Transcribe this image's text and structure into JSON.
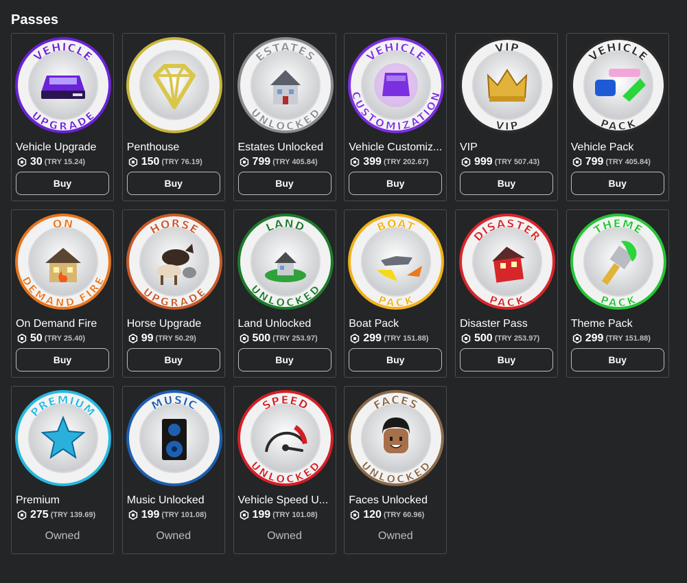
{
  "page": {
    "title": "Passes"
  },
  "passes": [
    {
      "name": "Vehicle Upgrade",
      "price": "30",
      "price_try": "(TRY 15.24)",
      "action": "Buy",
      "owned": false,
      "icon": "vehicle-upgrade-badge-icon",
      "badge_top": "VEHICLE",
      "badge_bottom": "UPGRADE",
      "accent": "#6a23d6"
    },
    {
      "name": "Penthouse",
      "price": "150",
      "price_try": "(TRY 76.19)",
      "action": "Buy",
      "owned": false,
      "icon": "penthouse-diamond-badge-icon",
      "badge_top": "",
      "badge_bottom": "",
      "accent": "#c8b53a"
    },
    {
      "name": "Estates Unlocked",
      "price": "799",
      "price_try": "(TRY 405.84)",
      "action": "Buy",
      "owned": false,
      "icon": "estates-unlocked-badge-icon",
      "badge_top": "ESTATES",
      "badge_bottom": "UNLOCKED",
      "accent": "#8a8c90"
    },
    {
      "name": "Vehicle Customiz...",
      "price": "399",
      "price_try": "(TRY 202.67)",
      "action": "Buy",
      "owned": false,
      "icon": "vehicle-customization-badge-icon",
      "badge_top": "VEHICLE",
      "badge_bottom": "CUSTOMIZATION",
      "accent": "#7b2fe0"
    },
    {
      "name": "VIP",
      "price": "999",
      "price_try": "(TRY 507.43)",
      "action": "Buy",
      "owned": false,
      "icon": "vip-crown-badge-icon",
      "badge_top": "VIP",
      "badge_bottom": "VIP",
      "accent": "#2b2b2b"
    },
    {
      "name": "Vehicle Pack",
      "price": "799",
      "price_try": "(TRY 405.84)",
      "action": "Buy",
      "owned": false,
      "icon": "vehicle-pack-badge-icon",
      "badge_top": "VEHICLE",
      "badge_bottom": "PACK",
      "accent": "#2b2b2b"
    },
    {
      "name": "On Demand Fire",
      "price": "50",
      "price_try": "(TRY 25.40)",
      "action": "Buy",
      "owned": false,
      "icon": "on-demand-fire-badge-icon",
      "badge_top": "ON",
      "badge_bottom": "DEMAND FIRE",
      "accent": "#e8761f"
    },
    {
      "name": "Horse Upgrade",
      "price": "99",
      "price_try": "(TRY 50.29)",
      "action": "Buy",
      "owned": false,
      "icon": "horse-upgrade-badge-icon",
      "badge_top": "HORSE",
      "badge_bottom": "UPGRADE",
      "accent": "#c85a2a"
    },
    {
      "name": "Land Unlocked",
      "price": "500",
      "price_try": "(TRY 253.97)",
      "action": "Buy",
      "owned": false,
      "icon": "land-unlocked-badge-icon",
      "badge_top": "LAND",
      "badge_bottom": "UNLOCKED",
      "accent": "#1e7a2c"
    },
    {
      "name": "Boat Pack",
      "price": "299",
      "price_try": "(TRY 151.88)",
      "action": "Buy",
      "owned": false,
      "icon": "boat-pack-badge-icon",
      "badge_top": "BOAT",
      "badge_bottom": "PACK",
      "accent": "#f0b21a"
    },
    {
      "name": "Disaster Pass",
      "price": "500",
      "price_try": "(TRY 253.97)",
      "action": "Buy",
      "owned": false,
      "icon": "disaster-pass-badge-icon",
      "badge_top": "DISASTER",
      "badge_bottom": "PACK",
      "accent": "#d8262a"
    },
    {
      "name": "Theme Pack",
      "price": "299",
      "price_try": "(TRY 151.88)",
      "action": "Buy",
      "owned": false,
      "icon": "theme-pack-brush-badge-icon",
      "badge_top": "THEME",
      "badge_bottom": "PACK",
      "accent": "#25c435"
    },
    {
      "name": "Premium",
      "price": "275",
      "price_try": "(TRY 139.69)",
      "action": "Owned",
      "owned": true,
      "icon": "premium-star-badge-icon",
      "badge_top": "PREMIUM",
      "badge_bottom": "",
      "accent": "#28b8e0"
    },
    {
      "name": "Music Unlocked",
      "price": "199",
      "price_try": "(TRY 101.08)",
      "action": "Owned",
      "owned": true,
      "icon": "music-speaker-badge-icon",
      "badge_top": "MUSIC",
      "badge_bottom": "",
      "accent": "#1e5fb0"
    },
    {
      "name": "Vehicle Speed U...",
      "price": "199",
      "price_try": "(TRY 101.08)",
      "action": "Owned",
      "owned": true,
      "icon": "vehicle-speed-gauge-badge-icon",
      "badge_top": "SPEED",
      "badge_bottom": "UNLOCKED",
      "accent": "#d41f26"
    },
    {
      "name": "Faces Unlocked",
      "price": "120",
      "price_try": "(TRY 60.96)",
      "action": "Owned",
      "owned": true,
      "icon": "faces-unlocked-badge-icon",
      "badge_top": "FACES",
      "badge_bottom": "UNLOCKED",
      "accent": "#8a6a4a"
    }
  ],
  "colors": {
    "background": "#232527",
    "card_border": "#4a4c4f",
    "text": "#ffffff",
    "muted_text": "#bdbebe"
  }
}
